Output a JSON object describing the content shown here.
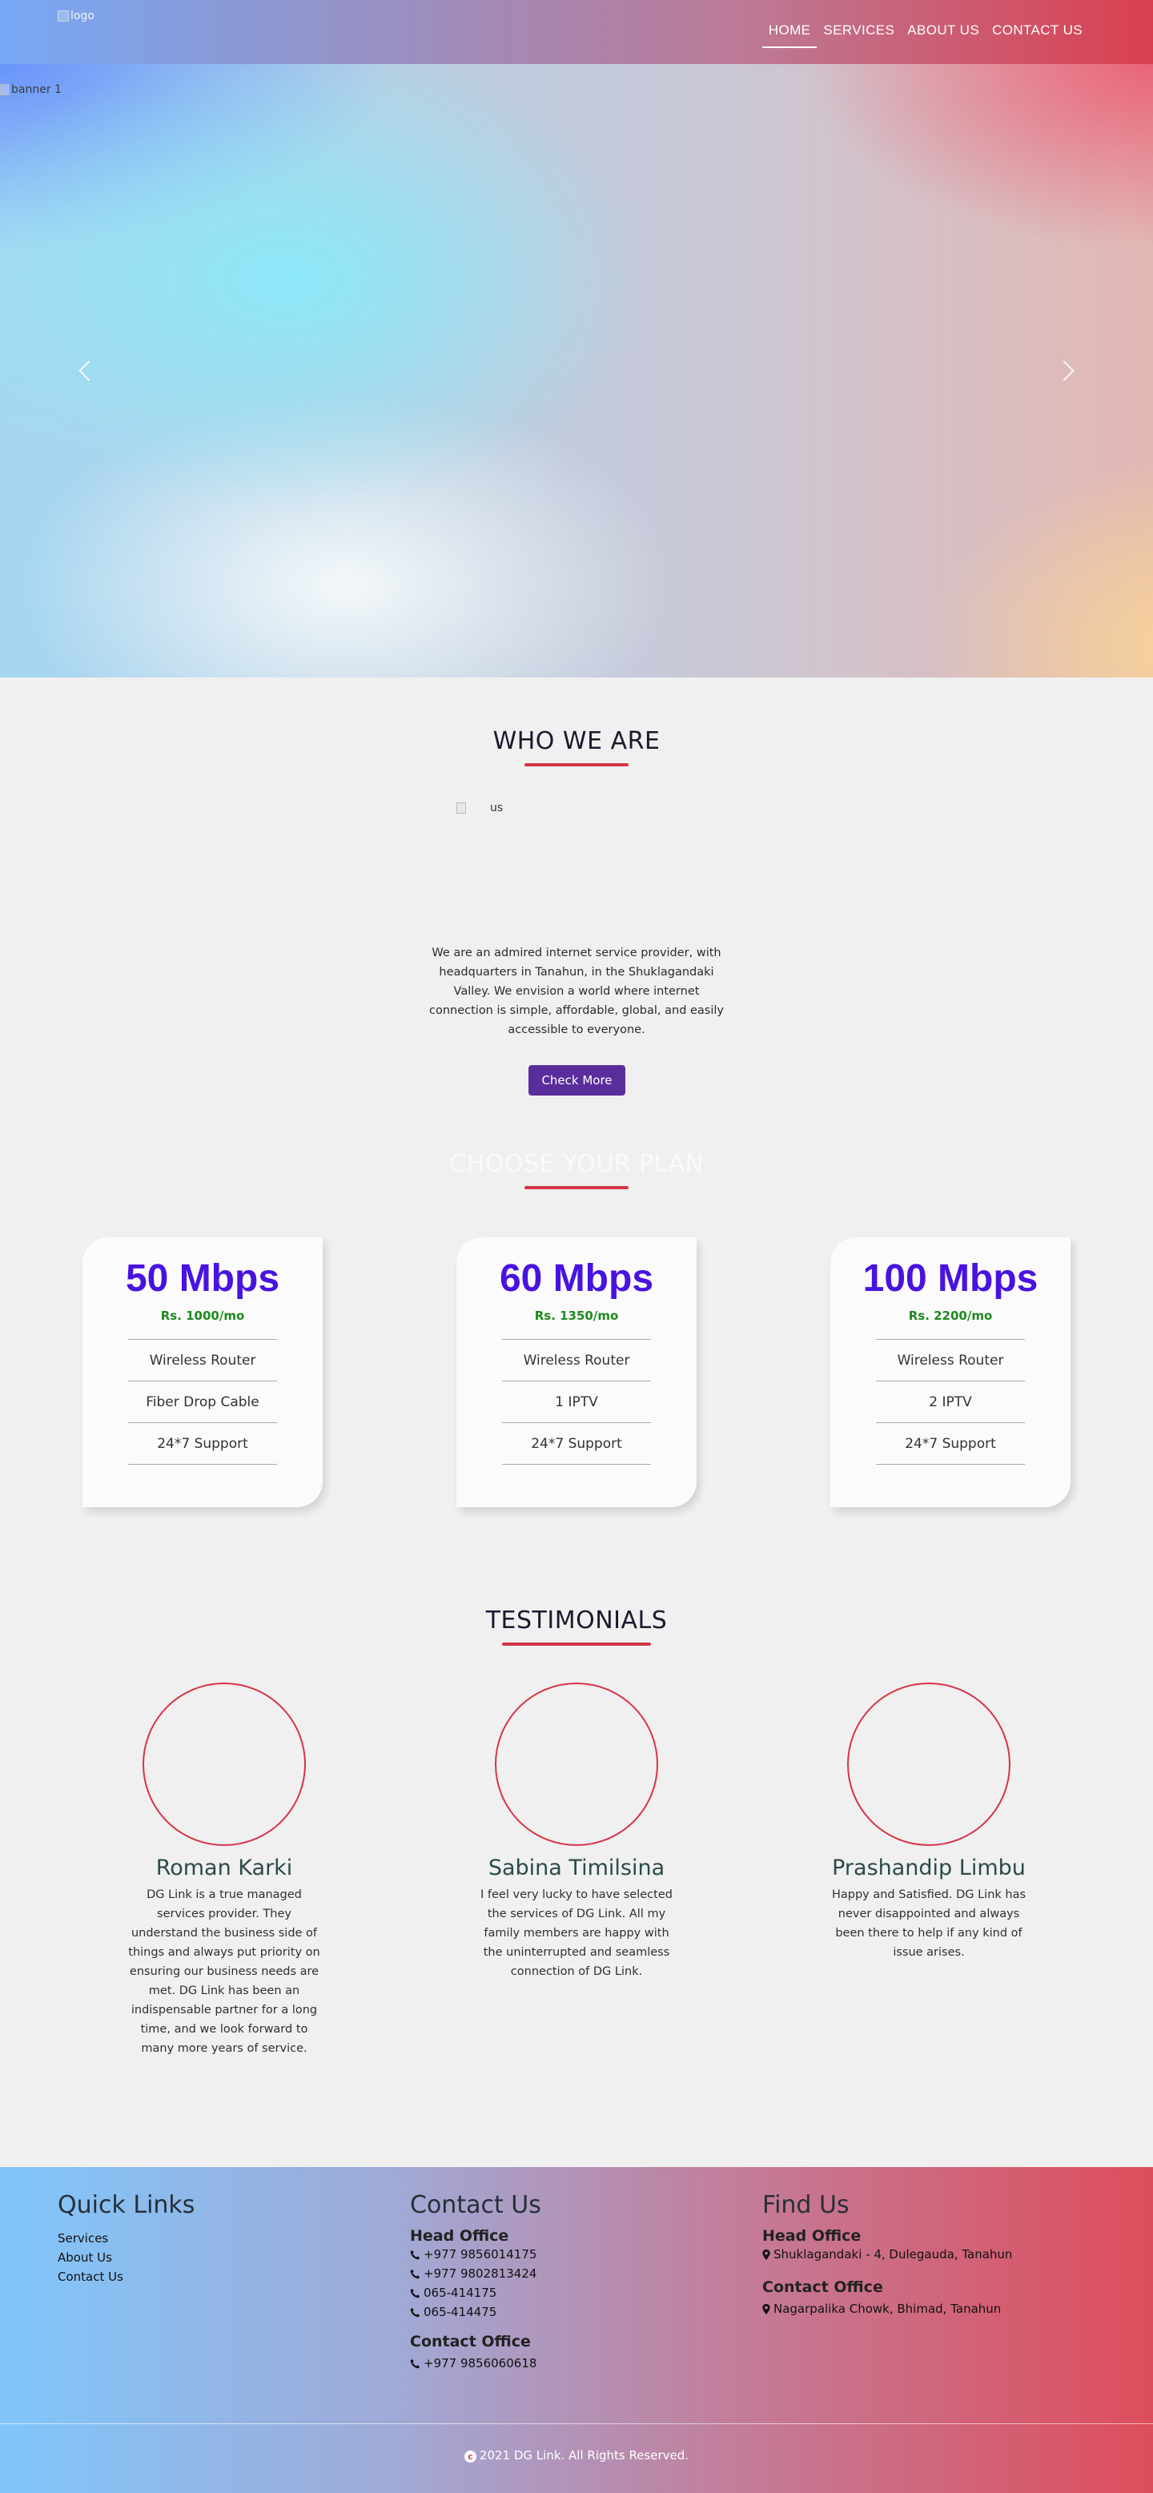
{
  "header": {
    "logo_alt": "logo",
    "nav": [
      "HOME",
      "SERVICES",
      "ABOUT US",
      "CONTACT US"
    ],
    "active": "HOME"
  },
  "hero": {
    "banner_alt": "banner 1",
    "prev_icon": "chevron-left-icon",
    "next_icon": "chevron-right-icon"
  },
  "who": {
    "title": "WHO WE ARE",
    "image_alt": "us",
    "description": "We are an admired internet service provider, with headquarters in Tanahun, in the Shuklagandaki Valley. We envision a world where internet connection is simple, affordable, global, and easily accessible to everyone.",
    "button": "Check More"
  },
  "plans": {
    "title": "CHOOSE YOUR PLAN",
    "items": [
      {
        "speed": "50 Mbps",
        "price": "Rs. 1000/mo",
        "features": [
          "Wireless Router",
          "Fiber Drop Cable",
          "24*7 Support"
        ]
      },
      {
        "speed": "60 Mbps",
        "price": "Rs. 1350/mo",
        "features": [
          "Wireless Router",
          "1 IPTV",
          "24*7 Support"
        ]
      },
      {
        "speed": "100 Mbps",
        "price": "Rs. 2200/mo",
        "features": [
          "Wireless Router",
          "2 IPTV",
          "24*7 Support"
        ]
      }
    ]
  },
  "testimonials": {
    "title": "TESTIMONIALS",
    "items": [
      {
        "name": "Roman Karki",
        "text": "DG Link is a true managed services provider. They understand the business side of things and always put priority on ensuring our business needs are met. DG Link has been an indispensable partner for a long time, and we look forward to many more years of service."
      },
      {
        "name": "Sabina Timilsina",
        "text": "I feel very lucky to have selected the services of DG Link. All my family members are happy with the uninterrupted and seamless connection of DG Link."
      },
      {
        "name": "Prashandip Limbu",
        "text": "Happy and Satisfied. DG Link has never disappointed and always been there to help if any kind of issue arises."
      }
    ]
  },
  "footer": {
    "quick_links": {
      "title": "Quick Links",
      "links": [
        "Services",
        "About Us",
        "Contact Us"
      ]
    },
    "contact": {
      "title": "Contact Us",
      "head_office_label": "Head Office",
      "head_phones": [
        "+977 9856014175",
        "+977 9802813424",
        "065-414175",
        "065-414475"
      ],
      "contact_office_label": "Contact Office",
      "contact_phones": [
        "+977 9856060618"
      ]
    },
    "find": {
      "title": "Find Us",
      "head_office_label": "Head Office",
      "head_address": "Shuklagandaki - 4, Dulegauda, Tanahun",
      "contact_office_label": "Contact Office",
      "contact_address": "Nagarpalika Chowk, Bhimad, Tanahun"
    },
    "copyright": "2021 DG Link. All Rights Reserved."
  },
  "colors": {
    "accent": "#d63447",
    "button": "#5a2d9c",
    "plan_speed": "#4813e0",
    "plan_price": "#1e8a1e"
  }
}
